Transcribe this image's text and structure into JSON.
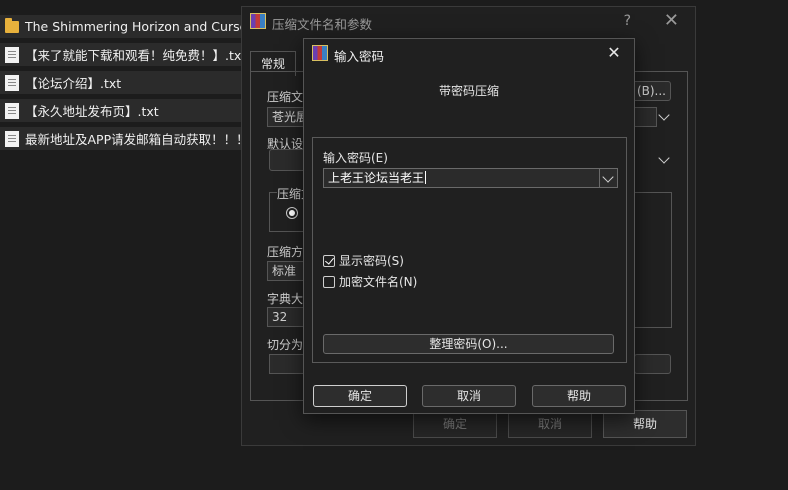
{
  "files": [
    {
      "name": "The Shimmering Horizon and Cursed",
      "icon": "folder-icon"
    },
    {
      "name": "【来了就能下载和观看！纯免费！】.txt",
      "icon": "text-file-icon"
    },
    {
      "name": "【论坛介绍】.txt",
      "icon": "text-file-icon"
    },
    {
      "name": "【永久地址发布页】.txt",
      "icon": "text-file-icon"
    },
    {
      "name": "最新地址及APP请发邮箱自动获取！！！.",
      "icon": "text-file-icon"
    }
  ],
  "back_dialog": {
    "title": "压缩文件名和参数",
    "help_symbol": "?",
    "close_symbol": "✕",
    "tab_general": "常规",
    "archive_name_label": "压缩文",
    "archive_name_value": "苍光展",
    "browse_fragment": "(B)...",
    "default_settings_label": "默认设",
    "format_label": "压缩文",
    "method_label": "压缩方",
    "method_value": "标准",
    "dict_label": "字典大",
    "dict_value": "32",
    "split_label": "切分为",
    "ok": "确定",
    "cancel": "取消",
    "help": "帮助"
  },
  "password_dialog": {
    "title": "输入密码",
    "close_symbol": "✕",
    "subtitle": "带密码压缩",
    "password_label": "输入密码(E)",
    "password_value": "上老王论坛当老王",
    "show_password_label": "显示密码(S)",
    "show_password_checked": true,
    "encrypt_filenames_label": "加密文件名(N)",
    "encrypt_filenames_checked": false,
    "organize_button": "整理密码(O)...",
    "ok": "确定",
    "cancel": "取消",
    "help": "帮助"
  }
}
